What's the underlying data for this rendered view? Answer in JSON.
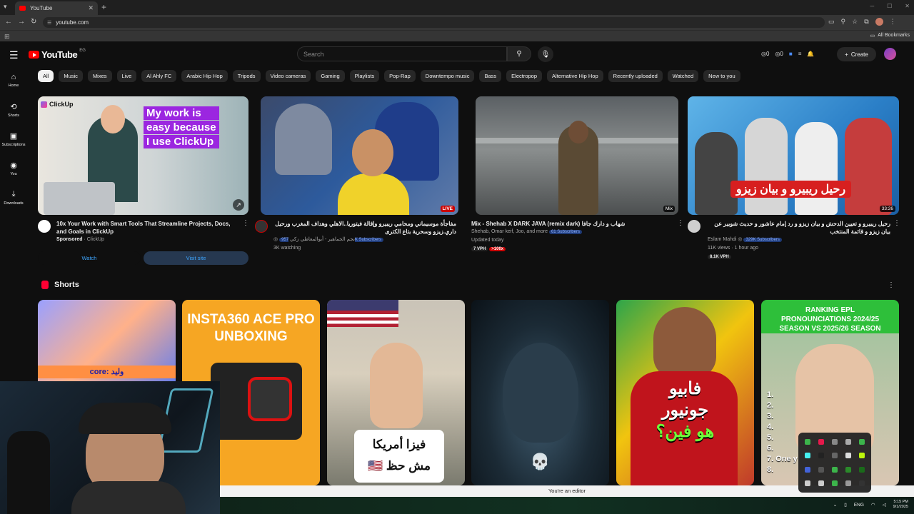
{
  "browser": {
    "tab_title": "YouTube",
    "url": "youtube.com",
    "all_bookmarks": "All Bookmarks"
  },
  "header": {
    "logo_text": "YouTube",
    "country_code": "EG",
    "search_placeholder": "Search",
    "create_label": "Create",
    "ext_count_1": "0",
    "ext_count_2": "0"
  },
  "guide": [
    {
      "label": "Home",
      "icon": "home-icon"
    },
    {
      "label": "Shorts",
      "icon": "shorts-icon"
    },
    {
      "label": "Subscriptions",
      "icon": "subscriptions-icon"
    },
    {
      "label": "You",
      "icon": "you-icon"
    },
    {
      "label": "Downloads",
      "icon": "download-icon"
    }
  ],
  "chips": [
    "All",
    "Music",
    "Mixes",
    "Live",
    "Al Ahly FC",
    "Arabic Hip Hop",
    "Tripods",
    "Video cameras",
    "Gaming",
    "Playlists",
    "Pop-Rap",
    "Downtempo music",
    "Bass",
    "Electropop",
    "Alternative Hip Hop",
    "Recently uploaded",
    "Watched",
    "New to you"
  ],
  "videos": [
    {
      "thumb_text_1": "ClickUp",
      "thumb_text_2": "My work is",
      "thumb_text_3": "easy because",
      "thumb_text_4": "I use ",
      "thumb_text_5": "ClickUp",
      "title": "10x Your Work with Smart Tools That Streamline Projects, Docs, and Goals in ClickUp",
      "sponsored": "Sponsored",
      "channel": "ClickUp",
      "watch_label": "Watch",
      "visit_label": "Visit site"
    },
    {
      "badge": "LIVE",
      "title": "مفاجأة موسيماني ومحامي ريبيرو وإقالة فيتوريا..الاهلي وهداف المغرب ورحيل داري.زيزو وسحرية بتاع الكترى",
      "channel": "نجم الجماهير - أبوالمعاطي زكي",
      "subs": "957K Subscribers",
      "meta": "3K watching"
    },
    {
      "badge": "Mix",
      "title": "Mix - Shehab X DARK   JAVA (remix dark)  شهاب و دارك  جافا",
      "channel": "Shehab, Omar keif, Joo, and more",
      "subs": "61 Subscribers",
      "meta": "Updated today",
      "vph": "7 VPH",
      "pill": ">100x"
    },
    {
      "badge": "33:26",
      "thumb_text": "رحيل ريبيرو و بيان زيزو",
      "title": "رحيل ريبيرو و تعيين الدحش و بيان زيزو و رد إمام عاشور و حديث شوبير عن بيان زيزو و قائمة المنتخب",
      "channel": "Eslam Mahdi",
      "subs": "329K Subscribers",
      "meta": "11K views · 1 hour ago",
      "vph": "8.1K VPH"
    }
  ],
  "shorts": {
    "title": "Shorts",
    "items": [
      {
        "caption": "وليد :core"
      },
      {
        "caption_1": "INSTA360 ACE PRO",
        "caption_2": "UNBOXING"
      },
      {
        "caption_1": "فيزا أمريكا",
        "caption_2": "مش حظ 🇺🇸"
      },
      {
        "caption": "💀"
      },
      {
        "caption_1": "فابيو",
        "caption_2": "جونيور",
        "caption_3": "هو فين؟"
      },
      {
        "caption_1": "RANKING EPL",
        "caption_2": "PRONOUNCIATIONS 2024/25",
        "caption_3": "SEASON VS 2025/26 SEASON",
        "list": [
          "1.",
          "2.",
          "3.",
          "4.",
          "5.",
          "6.",
          "7. One y",
          "8."
        ]
      }
    ]
  },
  "system": {
    "editor_notice": "You're an editor",
    "lang": "ENG",
    "time": "5:15 PM",
    "date": "9/1/2025"
  },
  "colors": {
    "brand_red": "#ff0000",
    "background": "#0f0f0f",
    "chip_bg": "#272727"
  }
}
